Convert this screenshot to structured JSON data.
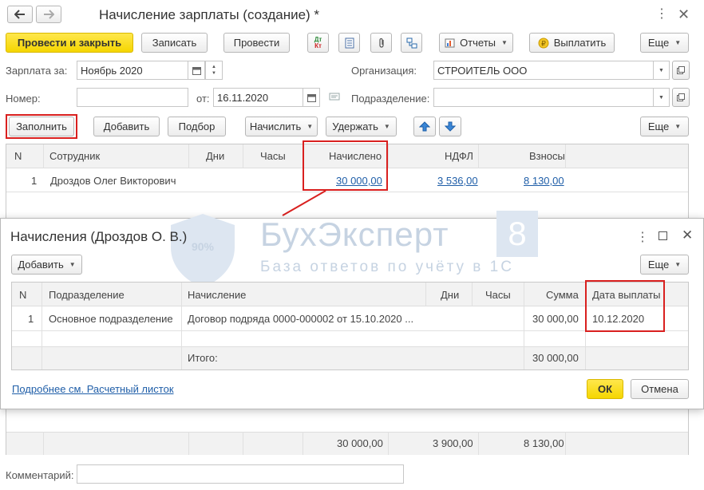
{
  "window": {
    "title": "Начисление зарплаты (создание) *"
  },
  "toolbar": {
    "post_close": "Провести и закрыть",
    "save": "Записать",
    "post": "Провести",
    "reports": "Отчеты",
    "pay": "Выплатить",
    "more": "Еще"
  },
  "header": {
    "salary_for_label": "Зарплата за:",
    "salary_for_value": "Ноябрь 2020",
    "org_label": "Организация:",
    "org_value": "СТРОИТЕЛЬ ООО",
    "number_label": "Номер:",
    "number_value": "",
    "from_label": "от:",
    "date_value": "16.11.2020",
    "division_label": "Подразделение:",
    "division_value": ""
  },
  "actions": {
    "fill": "Заполнить",
    "add": "Добавить",
    "select": "Подбор",
    "accrue": "Начислить",
    "withhold": "Удержать",
    "more": "Еще"
  },
  "main_table": {
    "columns": [
      "N",
      "Сотрудник",
      "Дни",
      "Часы",
      "Начислено",
      "НДФЛ",
      "Взносы"
    ],
    "rows": [
      {
        "n": "1",
        "employee": "Дроздов Олег Викторович",
        "days": "",
        "hours": "",
        "accrued": "30 000,00",
        "ndfl": "3 536,00",
        "contrib": "8 130,00"
      }
    ],
    "totals": {
      "accrued": "30 000,00",
      "ndfl": "3 900,00",
      "contrib": "8 130,00"
    }
  },
  "comment_label": "Комментарий:",
  "comment_value": "",
  "dialog": {
    "title": "Начисления (Дроздов О. В.)",
    "add": "Добавить",
    "more": "Еще",
    "columns": [
      "N",
      "Подразделение",
      "Начисление",
      "Дни",
      "Часы",
      "Сумма",
      "Дата выплаты"
    ],
    "rows": [
      {
        "n": "1",
        "division": "Основное подразделение",
        "accrual": "Договор подряда 0000-000002 от 15.10.2020 ...",
        "days": "",
        "hours": "",
        "sum": "30 000,00",
        "pay_date": "10.12.2020"
      }
    ],
    "total_label": "Итого:",
    "total_sum": "30 000,00",
    "link": "Подробнее см. Расчетный листок",
    "ok": "ОК",
    "cancel": "Отмена"
  },
  "watermark": {
    "brand": "БухЭксперт",
    "digit": "8",
    "tagline": "База ответов по учёту в 1С"
  },
  "colors": {
    "accent_yellow": "#f5d600",
    "highlight_red": "#d9201f",
    "link_blue": "#1f5ea8"
  }
}
